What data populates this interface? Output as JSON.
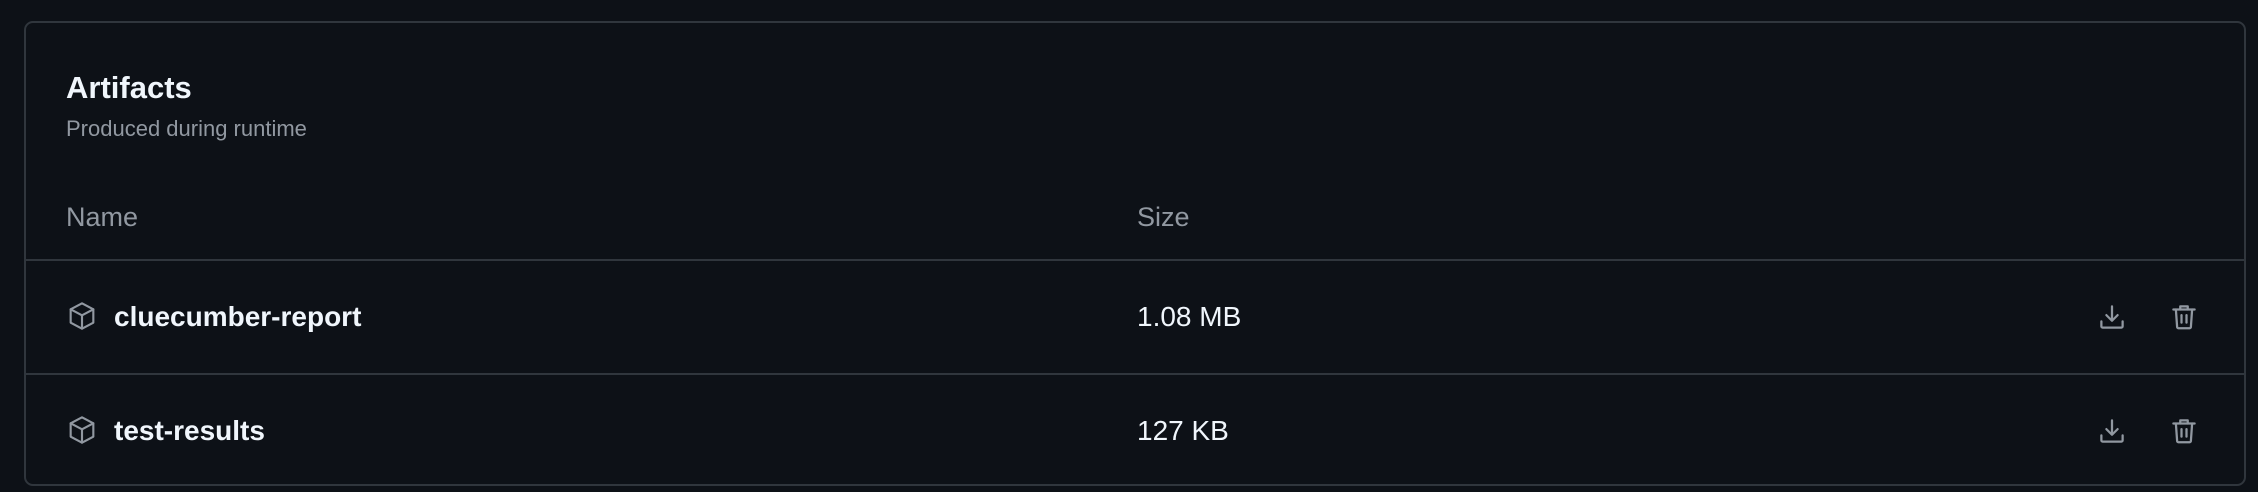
{
  "artifacts": {
    "title": "Artifacts",
    "subtitle": "Produced during runtime",
    "columns": {
      "name": "Name",
      "size": "Size"
    },
    "rows": [
      {
        "name": "cluecumber-report",
        "size": "1.08 MB",
        "icon": "package-icon",
        "actions": [
          "download-icon",
          "trash-icon"
        ]
      },
      {
        "name": "test-results",
        "size": "127 KB",
        "icon": "package-icon",
        "actions": [
          "download-icon",
          "trash-icon"
        ]
      }
    ]
  },
  "colors": {
    "background": "#0d1117",
    "border": "#30363d",
    "text_primary": "#f0f6fc",
    "text_muted": "#9198a1"
  }
}
